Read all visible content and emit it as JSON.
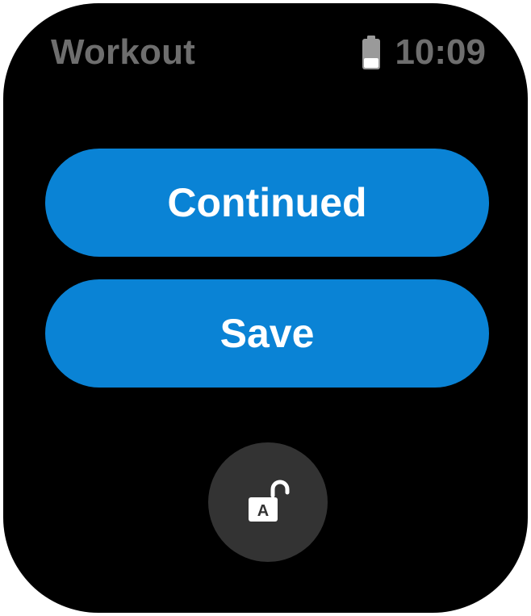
{
  "status_bar": {
    "app_title": "Workout",
    "time": "10:09",
    "battery_icon": "battery-icon"
  },
  "actions": {
    "continue_label": "Continued",
    "save_label": "Save"
  },
  "lock": {
    "icon": "unlock-icon",
    "badge_letter": "A"
  },
  "colors": {
    "background": "#000000",
    "button_blue": "#0a83d5",
    "status_text": "#6e6e6e",
    "lock_button_bg": "#333333"
  }
}
